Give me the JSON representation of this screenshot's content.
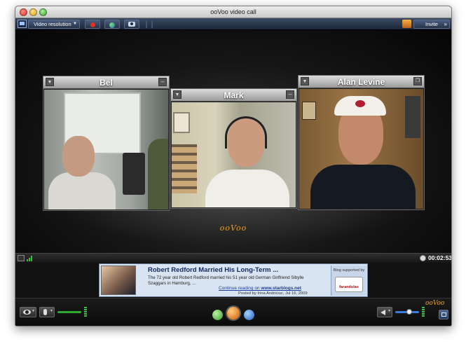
{
  "window": {
    "title": "ooVoo video call"
  },
  "toolbar": {
    "video_resolution_label": "Video resolution",
    "invite_label": "Invite"
  },
  "participants": [
    {
      "name": "Bel"
    },
    {
      "name": "Mark"
    },
    {
      "name": "Alan Levine"
    }
  ],
  "brand": {
    "logo_text": "ooVoo",
    "colors": {
      "accent": "#f0a020",
      "toolbar": "#25324a"
    }
  },
  "status": {
    "timer": "00:02:53"
  },
  "ad": {
    "headline": "Robert Redford Married His Long-Term ...",
    "body": "The 72 year old  Robert Redford married his 51 year old German Girlfriend Sibylle Szaggars in Hamburg, ...",
    "link_prefix": "Continue reading on ",
    "link": "www.starblogs.net",
    "posted": "Posted by Irina Andriciuc, Jul 16, 2009",
    "sponsor_label": "Blog supported by",
    "sponsor_name": "farandulas"
  },
  "bottom": {
    "logo_text": "ooVoo"
  },
  "icons": [
    "video-resolution-icon",
    "record-icon",
    "share-icon",
    "camera-icon",
    "invite-icon",
    "signal-icon",
    "clock-icon",
    "eye-icon",
    "mic-icon",
    "speaker-icon",
    "fullscreen-icon"
  ]
}
